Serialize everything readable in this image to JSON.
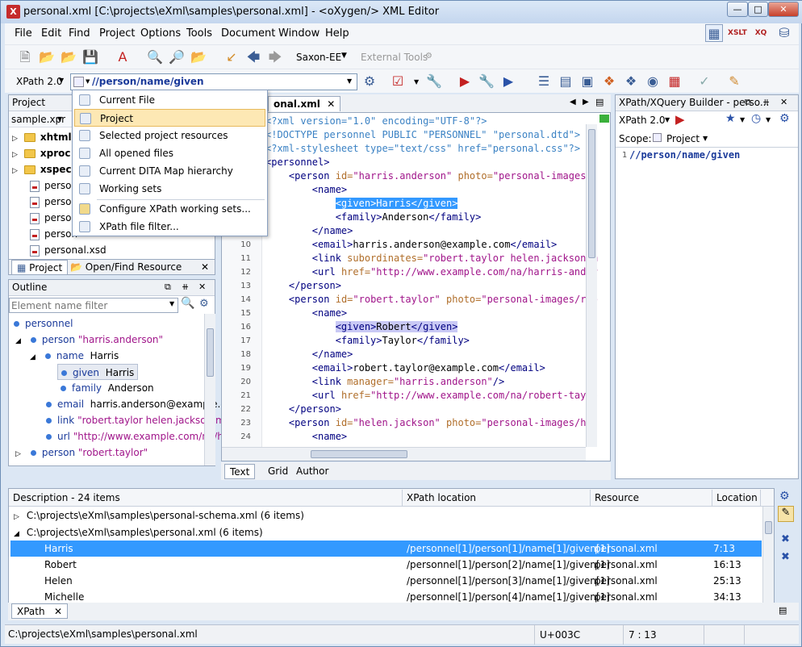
{
  "window": {
    "title": "personal.xml [C:\\projects\\eXml\\samples\\personal.xml] - <oXygen/> XML Editor"
  },
  "menu": [
    "File",
    "Edit",
    "Find",
    "Project",
    "Options",
    "Tools",
    "Document",
    "Window",
    "Help"
  ],
  "toolbar1": {
    "transformer": "Saxon-EE",
    "external_tools": "External Tools"
  },
  "xpath_bar": {
    "version": "XPath 2.0",
    "expression": "//person/name/given"
  },
  "scope_menu": {
    "items": [
      "Current File",
      "Project",
      "Selected project resources",
      "All opened files",
      "Current DITA Map hierarchy",
      "Working sets",
      "Configure XPath working sets...",
      "XPath file filter..."
    ],
    "selected_index": 1
  },
  "project_panel": {
    "title": "Project",
    "file": "sample.xpr",
    "items": [
      {
        "label": "xhtml",
        "type": "folder"
      },
      {
        "label": "xproc",
        "type": "folder"
      },
      {
        "label": "xspec",
        "type": "folder"
      },
      {
        "label": "person",
        "type": "file"
      },
      {
        "label": "person",
        "type": "file"
      },
      {
        "label": "person",
        "type": "file"
      },
      {
        "label": "person",
        "type": "file"
      },
      {
        "label": "personal.xsd",
        "type": "file"
      }
    ],
    "tabs": [
      "Project",
      "Open/Find Resource"
    ]
  },
  "outline": {
    "title": "Outline",
    "filter_placeholder": "Element name filter",
    "nodes": [
      {
        "name": "personnel",
        "value": "",
        "depth": 0
      },
      {
        "name": "person",
        "value": "\"harris.anderson\"",
        "depth": 1
      },
      {
        "name": "name",
        "value": "Harris",
        "depth": 2
      },
      {
        "name": "given",
        "value": "Harris",
        "depth": 3
      },
      {
        "name": "family",
        "value": "Anderson",
        "depth": 3
      },
      {
        "name": "email",
        "value": "harris.anderson@example.co",
        "depth": 2
      },
      {
        "name": "link",
        "value": "\"robert.taylor helen.jackson mic",
        "depth": 2
      },
      {
        "name": "url",
        "value": "\"http://www.example.com/na/ha",
        "depth": 2
      },
      {
        "name": "person",
        "value": "\"robert.taylor\"",
        "depth": 1
      }
    ]
  },
  "editor": {
    "tab": "onal.xml",
    "bottom_tabs": [
      "Text",
      "Grid",
      "Author"
    ],
    "line_numbers": [
      "",
      "",
      "",
      "",
      "",
      "",
      "",
      "",
      "",
      "10",
      "11",
      "12",
      "13",
      "14",
      "15",
      "16",
      "17",
      "18",
      "19",
      "20",
      "21",
      "22",
      "23",
      "24"
    ],
    "lines": [
      "<?xml version=\"1.0\" encoding=\"UTF-8\"?>",
      "<!DOCTYPE personnel PUBLIC \"PERSONNEL\" \"personal.dtd\">",
      "<?xml-stylesheet type=\"text/css\" href=\"personal.css\"?>",
      "<personnel>",
      "    <person id=\"harris.anderson\" photo=\"personal-images/h",
      "        <name>",
      "            <given>Harris</given>",
      "            <family>Anderson</family>",
      "        </name>",
      "        <email>harris.anderson@example.com</email>",
      "        <link subordinates=\"robert.taylor helen.jackson m",
      "        <url href=\"http://www.example.com/na/harris-ander",
      "    </person>",
      "    <person id=\"robert.taylor\" photo=\"personal-images/rob",
      "        <name>",
      "            <given>Robert</given>",
      "            <family>Taylor</family>",
      "        </name>",
      "        <email>robert.taylor@example.com</email>",
      "        <link manager=\"harris.anderson\"/>",
      "        <url href=\"http://www.example.com/na/robert-taylo",
      "    </person>",
      "    <person id=\"helen.jackson\" photo=\"personal-images/hel",
      "        <name>"
    ]
  },
  "builder": {
    "title": "XPath/XQuery Builder - perso...",
    "version": "XPath 2.0",
    "scope_label": "Scope:",
    "scope_value": "Project",
    "line_no": "1",
    "expression": "//person/name/given"
  },
  "results": {
    "columns": [
      "Description - 24 items",
      "XPath location",
      "Resource",
      "Location"
    ],
    "groups": [
      {
        "label": "C:\\projects\\eXml\\samples\\personal-schema.xml (6 items)"
      },
      {
        "label": "C:\\projects\\eXml\\samples\\personal.xml (6 items)"
      }
    ],
    "rows": [
      {
        "desc": "Harris",
        "xpath": "/personnel[1]/person[1]/name[1]/given[1]",
        "resource": "personal.xml",
        "location": "7:13"
      },
      {
        "desc": "Robert",
        "xpath": "/personnel[1]/person[2]/name[1]/given[1]",
        "resource": "personal.xml",
        "location": "16:13"
      },
      {
        "desc": "Helen",
        "xpath": "/personnel[1]/person[3]/name[1]/given[1]",
        "resource": "personal.xml",
        "location": "25:13"
      },
      {
        "desc": "Michelle",
        "xpath": "/personnel[1]/person[4]/name[1]/given[1]",
        "resource": "personal.xml",
        "location": "34:13"
      }
    ],
    "tab": "XPath"
  },
  "status": {
    "path": "C:\\projects\\eXml\\samples\\personal.xml",
    "char": "U+003C",
    "position": "7 : 13"
  }
}
